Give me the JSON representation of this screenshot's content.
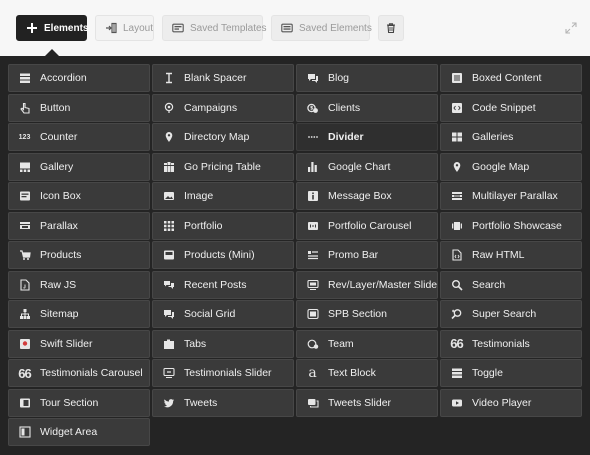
{
  "toolbar": {
    "elements_label": "Elements",
    "layout_label": "Layout",
    "saved_templates_label": "Saved Templates",
    "saved_elements_label": "Saved Elements"
  },
  "elements": [
    {
      "label": "Accordion",
      "icon": "accordion-icon"
    },
    {
      "label": "Blank Spacer",
      "icon": "spacer-icon"
    },
    {
      "label": "Blog",
      "icon": "blog-icon"
    },
    {
      "label": "Boxed Content",
      "icon": "boxed-content-icon"
    },
    {
      "label": "Button",
      "icon": "pointer-hand-icon"
    },
    {
      "label": "Campaigns",
      "icon": "map-pin-icon"
    },
    {
      "label": "Clients",
      "icon": "clients-icon"
    },
    {
      "label": "Code Snippet",
      "icon": "code-icon"
    },
    {
      "label": "Counter",
      "icon": "counter-icon",
      "glyph": "123"
    },
    {
      "label": "Directory Map",
      "icon": "location-pin-icon"
    },
    {
      "label": "Divider",
      "icon": "dots-divider-icon",
      "highlight": true
    },
    {
      "label": "Galleries",
      "icon": "galleries-icon"
    },
    {
      "label": "Gallery",
      "icon": "gallery-icon"
    },
    {
      "label": "Go Pricing Table",
      "icon": "pricing-table-icon"
    },
    {
      "label": "Google Chart",
      "icon": "bar-chart-icon"
    },
    {
      "label": "Google Map",
      "icon": "location-pin-icon"
    },
    {
      "label": "Icon Box",
      "icon": "icon-box-icon"
    },
    {
      "label": "Image",
      "icon": "image-icon"
    },
    {
      "label": "Message Box",
      "icon": "info-icon"
    },
    {
      "label": "Multilayer Parallax",
      "icon": "layers-icon"
    },
    {
      "label": "Parallax",
      "icon": "parallax-icon"
    },
    {
      "label": "Portfolio",
      "icon": "grid-icon"
    },
    {
      "label": "Portfolio Carousel",
      "icon": "carousel-icon"
    },
    {
      "label": "Portfolio Showcase",
      "icon": "showcase-icon"
    },
    {
      "label": "Products",
      "icon": "cart-icon"
    },
    {
      "label": "Products (Mini)",
      "icon": "products-mini-icon"
    },
    {
      "label": "Promo Bar",
      "icon": "promo-bar-icon"
    },
    {
      "label": "Raw HTML",
      "icon": "file-code-icon"
    },
    {
      "label": "Raw JS",
      "icon": "file-js-icon"
    },
    {
      "label": "Recent Posts",
      "icon": "recent-posts-icon"
    },
    {
      "label": "Rev/Layer/Master Slider",
      "icon": "slider-icon"
    },
    {
      "label": "Search",
      "icon": "search-icon"
    },
    {
      "label": "Sitemap",
      "icon": "sitemap-icon"
    },
    {
      "label": "Social Grid",
      "icon": "social-grid-icon"
    },
    {
      "label": "SPB Section",
      "icon": "section-icon"
    },
    {
      "label": "Super Search",
      "icon": "super-search-icon"
    },
    {
      "label": "Swift Slider",
      "icon": "swift-slider-icon"
    },
    {
      "label": "Tabs",
      "icon": "tabs-icon"
    },
    {
      "label": "Team",
      "icon": "team-icon"
    },
    {
      "label": "Testimonials",
      "icon": "quote-icon",
      "glyph": "66"
    },
    {
      "label": "Testimonials Carousel",
      "icon": "quote-carousel-icon",
      "glyph": "66"
    },
    {
      "label": "Testimonials Slider",
      "icon": "testimonials-slider-icon"
    },
    {
      "label": "Text Block",
      "icon": "text-block-icon",
      "glyph": "a"
    },
    {
      "label": "Toggle",
      "icon": "toggle-icon"
    },
    {
      "label": "Tour Section",
      "icon": "tour-icon"
    },
    {
      "label": "Tweets",
      "icon": "twitter-bird-icon"
    },
    {
      "label": "Tweets Slider",
      "icon": "tweets-slider-icon"
    },
    {
      "label": "Video Player",
      "icon": "play-icon"
    },
    {
      "label": "Widget Area",
      "icon": "widget-icon"
    }
  ],
  "colors": {
    "toolbar_bg": "#f7f7f7",
    "active_tab_bg": "#222222",
    "panel_bg": "#242424",
    "tile_bg": "#3a3a3a"
  }
}
